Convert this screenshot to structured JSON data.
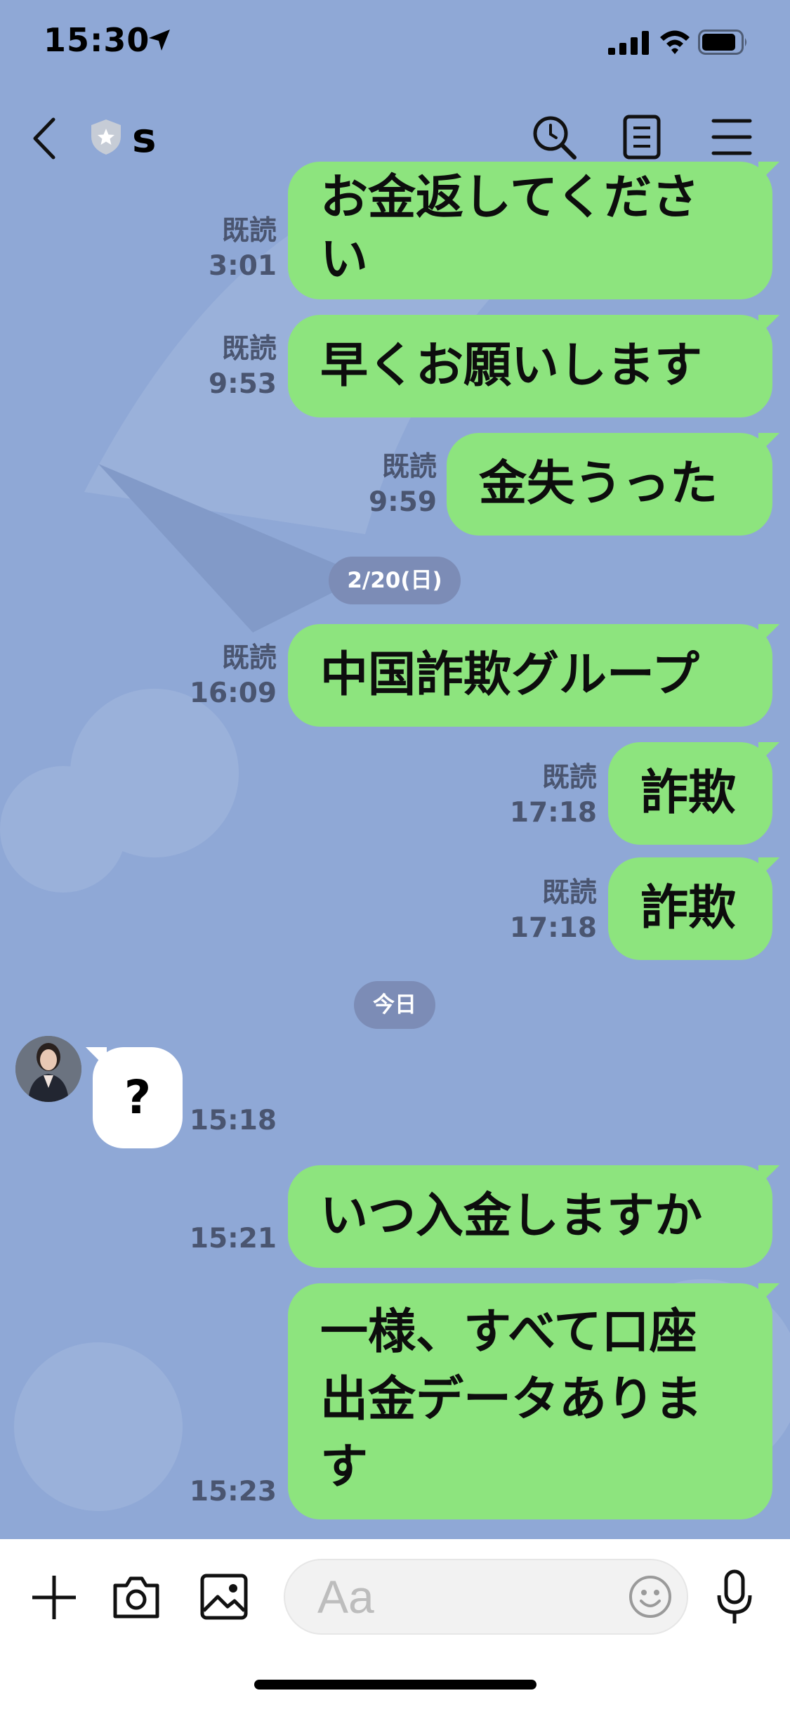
{
  "status_bar": {
    "time": "15:30"
  },
  "header": {
    "title": "s"
  },
  "messages": [
    {
      "text": "お金返してくださ\nい",
      "read": "既読",
      "time": "3:01"
    },
    {
      "text": "早くお願いします",
      "read": "既読",
      "time": "9:53"
    },
    {
      "text": "金失うった",
      "read": "既読",
      "time": "9:59"
    },
    {
      "date": "2/20(日)"
    },
    {
      "text": "中国詐欺グループ",
      "read": "既読",
      "time": "16:09"
    },
    {
      "text": "詐欺",
      "read": "既読",
      "time": "17:18"
    },
    {
      "text": "詐欺",
      "read": "既読",
      "time": "17:18"
    },
    {
      "date": "今日"
    },
    {
      "incoming": true,
      "text": "?",
      "time": "15:18"
    },
    {
      "text": "いつ入金しますか",
      "time": "15:21"
    },
    {
      "text": "一様、すべて口座出金データあります",
      "time": "15:23"
    }
  ],
  "input": {
    "placeholder": "Aa"
  },
  "colors": {
    "background": "#8fa8d6",
    "outgoing_bubble": "#8de47e",
    "incoming_bubble": "#ffffff",
    "date_pill": "#7c8cb6"
  },
  "icons": [
    "back-chevron",
    "shield-badge",
    "search",
    "notes",
    "menu",
    "plus",
    "camera",
    "image",
    "emoji",
    "microphone"
  ]
}
